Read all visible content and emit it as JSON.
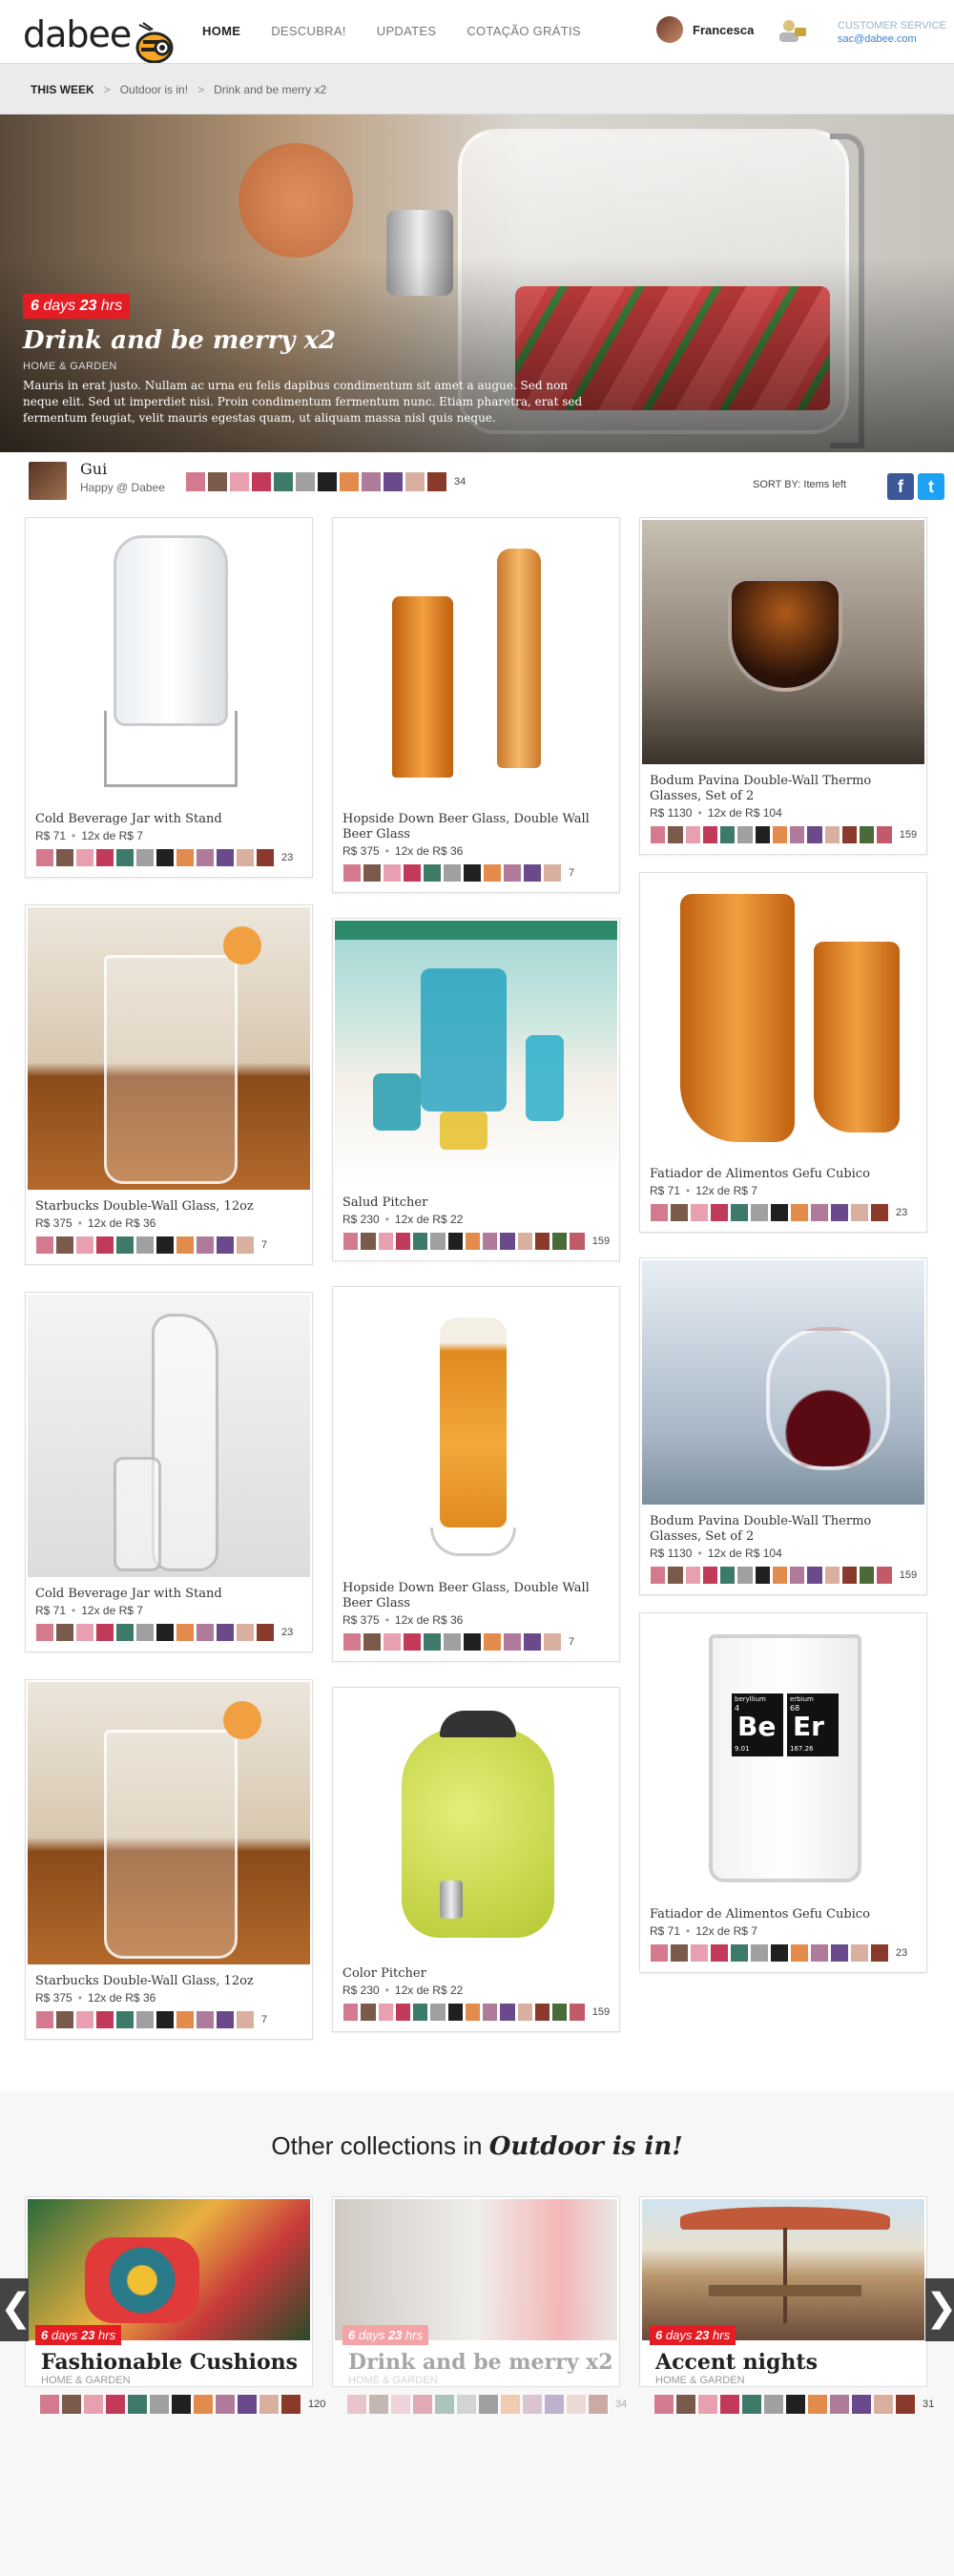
{
  "header": {
    "logo": "dabee",
    "nav": [
      "HOME",
      "DESCUBRA!",
      "UPDATES",
      "COTAÇÃO GRÁTIS"
    ],
    "user_name": "Francesca",
    "cs_label": "CUSTOMER SERVICE",
    "cs_email": "sac@dabee.com"
  },
  "breadcrumb": [
    "THIS WEEK",
    "Outdoor is in!",
    "Drink and be merry x2"
  ],
  "hero": {
    "timer_days": "6",
    "timer_days_label": "days",
    "timer_hrs": "23",
    "timer_hrs_label": "hrs",
    "title": "Drink and be merry x2",
    "category": "HOME & GARDEN",
    "description": "Mauris in erat justo. Nullam ac urna eu felis dapibus condimentum sit amet a augue. Sed non neque elit. Sed ut imperdiet nisi. Proin condimentum fermentum nunc. Etiam pharetra, erat sed fermentum feugiat, velit mauris egestas quam, ut aliquam massa nisl quis neque."
  },
  "curator": {
    "name": "Gui",
    "sub": "Happy @ Dabee",
    "count": "34"
  },
  "sort": "SORT BY: Items left",
  "social": {
    "facebook": "f",
    "twitter": "t"
  },
  "products": [
    {
      "title": "Cold Beverage Jar with Stand",
      "price": "R$ 71",
      "installments": "12x de R$ 7",
      "count": "23"
    },
    {
      "title": "Starbucks Double-Wall Glass, 12oz",
      "price": "R$ 375",
      "installments": "12x de R$ 36",
      "count": "7"
    },
    {
      "title": "Cold Beverage Jar with Stand",
      "price": "R$ 71",
      "installments": "12x de R$ 7",
      "count": "23"
    },
    {
      "title": "Starbucks Double-Wall Glass, 12oz",
      "price": "R$ 375",
      "installments": "12x de R$ 36",
      "count": "7"
    },
    {
      "title": "Hopside Down Beer Glass, Double Wall Beer Glass",
      "price": "R$ 375",
      "installments": "12x de R$ 36",
      "count": "7"
    },
    {
      "title": "Salud Pitcher",
      "price": "R$ 230",
      "installments": "12x de R$ 22",
      "count": "159"
    },
    {
      "title": "Hopside Down Beer Glass, Double Wall Beer Glass",
      "price": "R$ 375",
      "installments": "12x de R$ 36",
      "count": "7"
    },
    {
      "title": "Color Pitcher",
      "price": "R$ 230",
      "installments": "12x de R$ 22",
      "count": "159"
    },
    {
      "title": "Bodum Pavina Double-Wall Thermo Glasses, Set of 2",
      "price": "R$ 1130",
      "installments": "12x de R$ 104",
      "count": "159"
    },
    {
      "title": "Fatiador de Alimentos Gefu Cubico",
      "price": "R$ 71",
      "installments": "12x de R$ 7",
      "count": "23"
    },
    {
      "title": "Bodum Pavina Double-Wall Thermo Glasses, Set of 2",
      "price": "R$ 1130",
      "installments": "12x de R$ 104",
      "count": "159"
    },
    {
      "title": "Fatiador de Alimentos Gefu Cubico",
      "price": "R$ 71",
      "installments": "12x de R$ 7",
      "count": "23"
    }
  ],
  "beer_labels": {
    "be_top": "beryllium",
    "be_num": "4",
    "be_sym": "Be",
    "be_mass": "9.01",
    "er_top": "erbium",
    "er_num": "68",
    "er_sym": "Er",
    "er_mass": "167.26"
  },
  "other": {
    "title_prefix": "Other collections in",
    "title_em": "Outdoor is in!",
    "items": [
      {
        "timer_days": "6",
        "timer_hrs": "23",
        "name": "Fashionable Cushions",
        "category": "HOME & GARDEN",
        "count": "120"
      },
      {
        "timer_days": "6",
        "timer_hrs": "23",
        "name": "Drink and be merry x2",
        "category": "HOME & GARDEN",
        "count": "34"
      },
      {
        "timer_days": "6",
        "timer_hrs": "23",
        "name": "Accent nights",
        "category": "HOME & GARDEN",
        "count": "31"
      }
    ],
    "days_label": "days",
    "hrs_label": "hrs"
  },
  "arrows": {
    "left": "❮",
    "right": "❯"
  }
}
